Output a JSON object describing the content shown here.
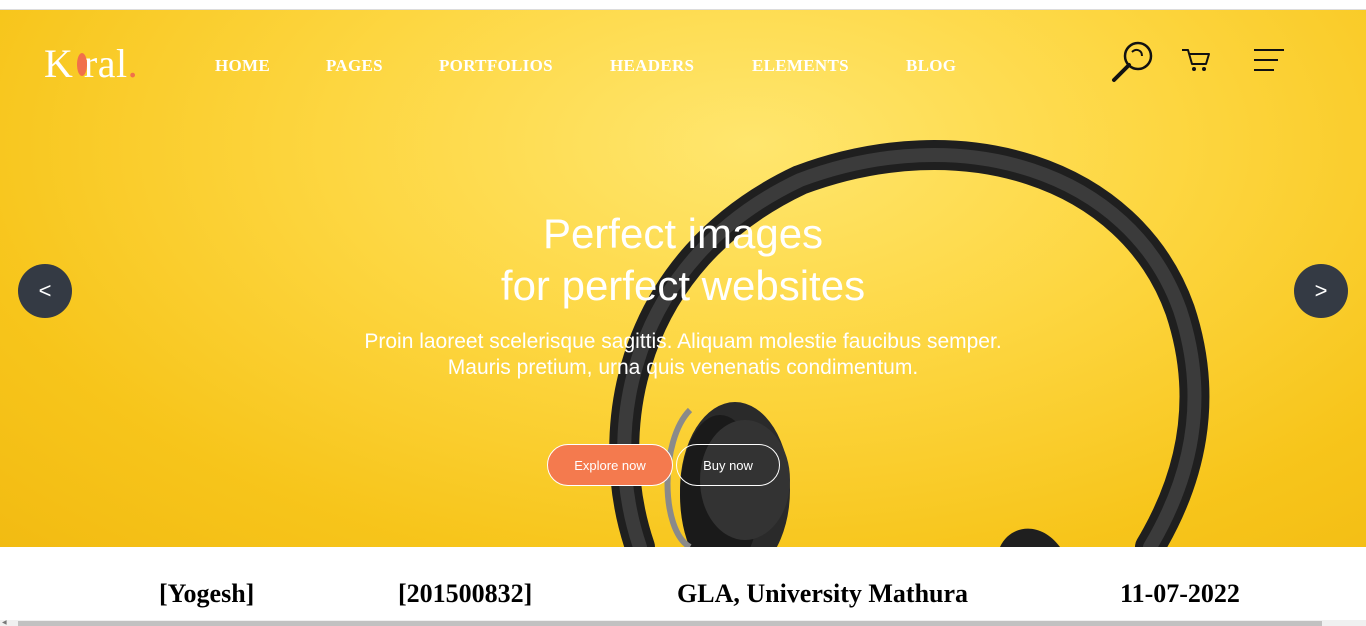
{
  "brand": {
    "logo_text": "K ral",
    "logo_dot": "."
  },
  "nav": {
    "items": [
      "HOME",
      "PAGES",
      "PORTFOLIOS",
      "HEADERS",
      "ELEMENTS",
      "BLOG"
    ]
  },
  "header_icons": [
    "search-icon",
    "cart-icon",
    "menu-icon"
  ],
  "slider": {
    "prev_label": "<",
    "next_label": ">",
    "title_line1": "Perfect images",
    "title_line2": "for perfect websites",
    "subtitle_line1": "Proin laoreet scelerisque sagittis. Aliquam molestie faucibus semper.",
    "subtitle_line2": "Mauris pretium, urna quis venenatis condimentum.",
    "primary_button": "Explore now",
    "secondary_button": "Buy now"
  },
  "footer": {
    "name": "[Yogesh]",
    "roll": "[201500832]",
    "university": "GLA, University Mathura",
    "date": "11-07-2022"
  },
  "colors": {
    "accent": "#f47a4e",
    "hero_bg": "#fdd640",
    "arrow_bg": "#343a44"
  }
}
